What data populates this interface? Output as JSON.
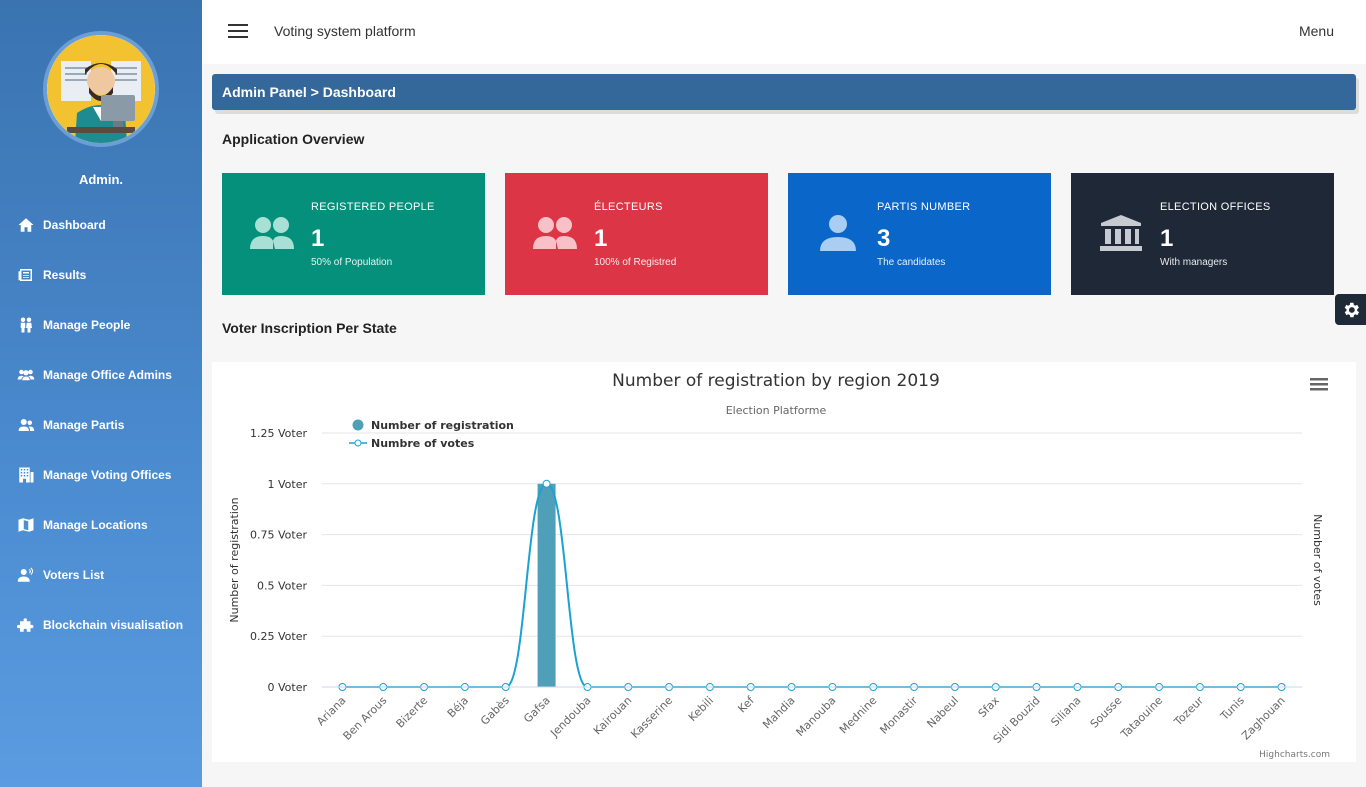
{
  "sidebar": {
    "username": "Admin.",
    "items": [
      {
        "label": "Dashboard",
        "icon": "home-icon"
      },
      {
        "label": "Results",
        "icon": "newspaper-icon"
      },
      {
        "label": "Manage People",
        "icon": "people-icon"
      },
      {
        "label": "Manage Office Admins",
        "icon": "users-icon"
      },
      {
        "label": "Manage Partis",
        "icon": "user-friends-icon"
      },
      {
        "label": "Manage Voting Offices",
        "icon": "building-icon"
      },
      {
        "label": "Manage Locations",
        "icon": "map-icon"
      },
      {
        "label": "Voters List",
        "icon": "user-voice-icon"
      },
      {
        "label": "Blockchain visualisation",
        "icon": "puzzle-icon"
      }
    ]
  },
  "topbar": {
    "title": "Voting system platform",
    "menu_label": "Menu"
  },
  "breadcrumb": "Admin Panel > Dashboard",
  "overview_title": "Application Overview",
  "cards": [
    {
      "label": "REGISTERED PEOPLE",
      "value": "1",
      "sub": "50% of Population",
      "color": "#04907a",
      "icon": "users-icon"
    },
    {
      "label": "ÉLECTEURS",
      "value": "1",
      "sub": "100% of Registred",
      "color": "#dc3545",
      "icon": "users-icon"
    },
    {
      "label": "PARTIS NUMBER",
      "value": "3",
      "sub": "The candidates",
      "color": "#0a66c8",
      "icon": "user-icon"
    },
    {
      "label": "ELECTION OFFICES",
      "value": "1",
      "sub": "With managers",
      "color": "#1e2837",
      "icon": "landmark-icon"
    }
  ],
  "chart_section_title": "Voter Inscription Per State",
  "chart_data": {
    "type": "bar",
    "title": "Number of registration by region 2019",
    "subtitle": "Election Platforme",
    "ylabel": "Number of registration",
    "ylabel_right": "Number of votes",
    "ylim": [
      0,
      1.25
    ],
    "yticks": [
      "0 Voter",
      "0.25 Voter",
      "0.5 Voter",
      "0.75 Voter",
      "1 Voter",
      "1.25 Voter"
    ],
    "yticks_values": [
      0,
      0.25,
      0.5,
      0.75,
      1,
      1.25
    ],
    "categories": [
      "Ariana",
      "Ben Arous",
      "Bizerte",
      "Béja",
      "Gabès",
      "Gafsa",
      "Jendouba",
      "Kairouan",
      "Kasserine",
      "Kebili",
      "Kef",
      "Mahdia",
      "Manouba",
      "Mednine",
      "Monastir",
      "Nabeul",
      "Sfax",
      "Sidi Bouzid",
      "Siliana",
      "Sousse",
      "Tataouine",
      "Tozeur",
      "Tunis",
      "Zaghouan"
    ],
    "series": [
      {
        "name": "Number of registration",
        "type": "bar",
        "color": "#4f9fb8",
        "values": [
          0,
          0,
          0,
          0,
          0,
          1,
          0,
          0,
          0,
          0,
          0,
          0,
          0,
          0,
          0,
          0,
          0,
          0,
          0,
          0,
          0,
          0,
          0,
          0
        ]
      },
      {
        "name": "Numbre of votes",
        "type": "spline",
        "color": "#1aa3d0",
        "values": [
          0,
          0,
          0,
          0,
          0,
          1,
          0,
          0,
          0,
          0,
          0,
          0,
          0,
          0,
          0,
          0,
          0,
          0,
          0,
          0,
          0,
          0,
          0,
          0
        ]
      }
    ],
    "legend_position": "top-left",
    "grid": true,
    "credits": "Highcharts.com"
  }
}
